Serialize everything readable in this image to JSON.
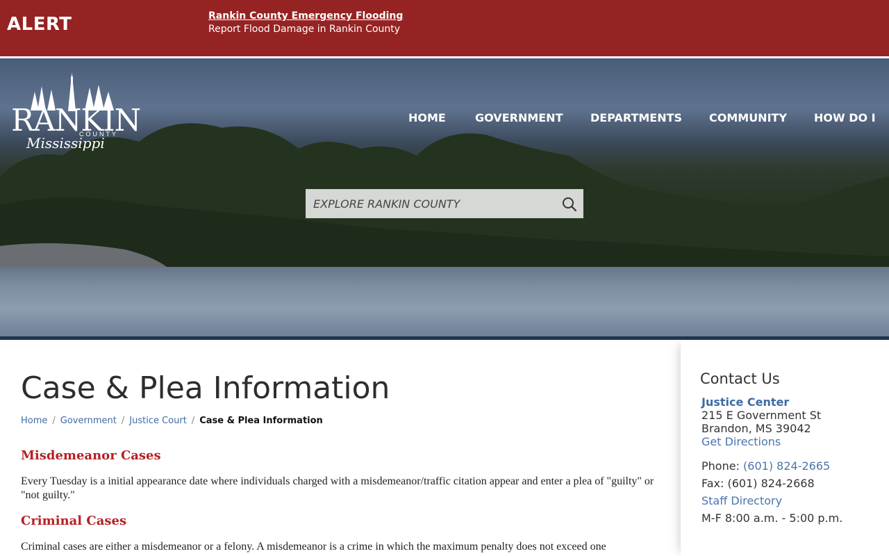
{
  "alert": {
    "label": "ALERT",
    "link_text": "Rankin County Emergency Flooding",
    "subtext": "Report Flood Damage in Rankin County"
  },
  "logo": {
    "name": "RANKIN",
    "county": "COUNTY",
    "state": "Mississippi"
  },
  "nav": {
    "items": [
      {
        "label": "HOME"
      },
      {
        "label": "GOVERNMENT"
      },
      {
        "label": "DEPARTMENTS"
      },
      {
        "label": "COMMUNITY"
      },
      {
        "label": "HOW DO I"
      }
    ]
  },
  "search": {
    "placeholder": "EXPLORE RANKIN COUNTY",
    "icon": "search-icon"
  },
  "main": {
    "title": "Case & Plea Information",
    "breadcrumb": [
      {
        "label": "Home"
      },
      {
        "label": "Government"
      },
      {
        "label": "Justice Court"
      },
      {
        "label": "Case & Plea Information"
      }
    ],
    "sections": [
      {
        "heading": "Misdemeanor Cases",
        "text": "Every Tuesday is a initial appearance date where individuals charged with a misdemeanor/traffic citation appear and enter a plea of \"guilty\" or \"not guilty.\""
      },
      {
        "heading": "Criminal Cases",
        "text": "Criminal cases are either a misdemeanor or a felony. A misdemeanor is a crime in which the maximum penalty does not exceed one"
      }
    ]
  },
  "sidebar": {
    "title": "Contact Us",
    "org": "Justice Center",
    "address1": "215 E Government St",
    "address2": "Brandon, MS 39042",
    "directions": "Get Directions",
    "phone_label": "Phone:",
    "phone": "(601) 824-2665",
    "fax": "Fax: (601) 824-2668",
    "staff": "Staff Directory",
    "hours": "M-F 8:00 a.m. - 5:00 p.m."
  },
  "colors": {
    "alert_bg": "#962323",
    "link_blue": "#3d6ba5",
    "heading_red": "#b41f24"
  }
}
